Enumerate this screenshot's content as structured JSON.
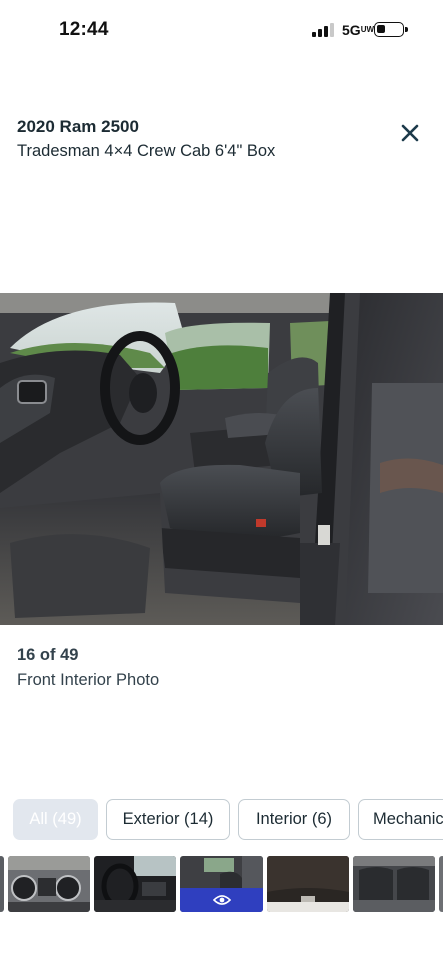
{
  "status_bar": {
    "time": "12:44",
    "network": "5G",
    "network_suffix": "UW",
    "signal_icon": "signal-bars-icon",
    "battery_icon": "battery-low-icon"
  },
  "header": {
    "title": "2020 Ram 2500",
    "subtitle": "Tradesman 4×4 Crew Cab 6'4\" Box",
    "close_icon": "close-icon"
  },
  "photo": {
    "counter": "16 of 49",
    "caption": "Front Interior Photo"
  },
  "filters": [
    {
      "label": "All (49)",
      "active": true
    },
    {
      "label": "Exterior (14)",
      "active": false
    },
    {
      "label": "Interior (6)",
      "active": false
    },
    {
      "label": "Mechanic",
      "active": false
    }
  ],
  "thumbnails": {
    "selected_index": 2,
    "selected_icon": "eye-icon",
    "items": [
      "dash-gauges",
      "steering-wheel-dash",
      "front-interior",
      "headliner",
      "rear-seat"
    ]
  },
  "colors": {
    "text_primary": "#1c2b33",
    "chip_active_bg": "#e2e7ee",
    "chip_border": "#c3ccd2",
    "selected_thumb_bar": "#2f3fbf"
  }
}
